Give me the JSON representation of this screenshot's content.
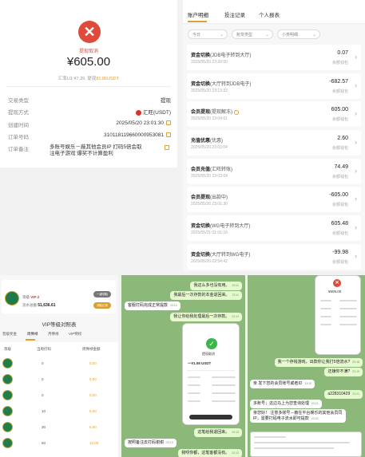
{
  "detail": {
    "status": "提现取消",
    "amount": "¥605.00",
    "rate_prefix": "汇率U1:¥7.39, 提现",
    "rate_usdt": "81.86USDT",
    "rows": [
      {
        "label": "交易类型",
        "value": "提现"
      },
      {
        "label": "提现方式",
        "value": "汇旺(USDT)"
      },
      {
        "label": "创建时间",
        "value": "2025/05/20 23:01:30"
      },
      {
        "label": "订单号码",
        "value": "310118119660000953081"
      },
      {
        "label": "订单备注",
        "value": "多账号娱乐－蔽其他会员IP 打码5倍会取注电子游戏 爆奖不计算盈利"
      }
    ]
  },
  "records": {
    "tabs": [
      "账户明细",
      "投注记录",
      "个人报表"
    ],
    "filters": [
      "今日",
      "账变类型",
      "小类明细"
    ],
    "items": [
      {
        "title": "资金切换",
        "sub": "(JDB电子转到大厅)",
        "date": "2025/05/20 23:20:50",
        "amount": "0.07",
        "account": "余额钱包"
      },
      {
        "title": "资金切换",
        "sub": "(大厅转到JDB电子)",
        "date": "2025/05/20 23:13:32",
        "amount": "-682.57",
        "account": "余额钱包"
      },
      {
        "title": "会员提现",
        "sub": "(提现解冻)",
        "date": "2025/05/20 23:04:01",
        "amount": "605.00",
        "account": "余额钱包"
      },
      {
        "title": "充值优惠",
        "sub": "(优惠)",
        "date": "2025/05/20 23:03:04",
        "amount": "2.60",
        "account": "余额钱包"
      },
      {
        "title": "会员充值",
        "sub": "(汇旺转账)",
        "date": "2025/05/20 23:03:04",
        "amount": "74.49",
        "account": "余额钱包"
      },
      {
        "title": "会员提现",
        "sub": "(出款中)",
        "date": "2025/05/20 23:01:30",
        "amount": "-605.00",
        "account": "余额钱包"
      },
      {
        "title": "资金切换",
        "sub": "(WG电子转到大厅)",
        "date": "2025/05/21 01:01:16",
        "amount": "605.48",
        "account": "余额钱包"
      },
      {
        "title": "资金切换",
        "sub": "(大厅转到WG电子)",
        "date": "2025/05/20 22:54:42",
        "amount": "-99.98",
        "account": "余额钱包"
      }
    ]
  },
  "vip": {
    "level_prefix": "等级",
    "level": "VIP 2",
    "balance_prefix": "流水总额",
    "balance": "51,636.61",
    "btn1": "一键领取",
    "btn2": "领取记录",
    "heading": "VIP等级对照表",
    "tabs": [
      "晋级奖金",
      "周俸禄",
      "月俸禄",
      "VIP特权"
    ],
    "head": [
      "等级",
      "当周打码",
      "周俸禄金额"
    ],
    "rows": [
      {
        "bet": "0",
        "reward": "0.00"
      },
      {
        "bet": "0",
        "reward": "0.00"
      },
      {
        "bet": "0",
        "reward": "0.00"
      },
      {
        "bet": "10",
        "reward": "5.00"
      },
      {
        "bet": "30",
        "reward": "6.00"
      },
      {
        "bet": "50",
        "reward": "10.00"
      }
    ]
  },
  "chat1": {
    "msgs": [
      {
        "text": "我这么多也没有用。",
        "time": "23:11"
      },
      {
        "text": "我最后一次存款的本金退回来。",
        "time": "23:11"
      },
      {
        "text": "客服打码完成正常提款",
        "time": "23:12"
      },
      {
        "text": "我让你给我处理最后一次存款。",
        "time": "23:13"
      },
      {
        "text": "这笔给我退回来。",
        "time": "23:13"
      },
      {
        "text": "按照备注去打码谢谢",
        "time": "23:13"
      },
      {
        "text": "我呀你都，这笔客都没有。",
        "time": "23:13"
      }
    ],
    "phone": {
      "title": "提现取消",
      "amount": "一¥1.08 USDT"
    }
  },
  "chat2": {
    "phone_amount": "¥605.00",
    "msgs": [
      {
        "text": "我一个存钱游戏，出款你让我打5倍流水?",
        "time": "23:18"
      },
      {
        "text": "还嫌你不满?",
        "time": "23:19"
      },
      {
        "text": "亲 发下您的会员账号或者ID",
        "time": "23:20"
      },
      {
        "text": "a228310429",
        "time": "23:21"
      },
      {
        "text": "多账号；这边马上为您查询处理",
        "time": "23:21"
      },
      {
        "text": "亲您好！ 注意多账号－蔽在平台娱乐的其他会员同IP，需要打码电子流水即可提款",
        "time": "23:22"
      }
    ]
  }
}
